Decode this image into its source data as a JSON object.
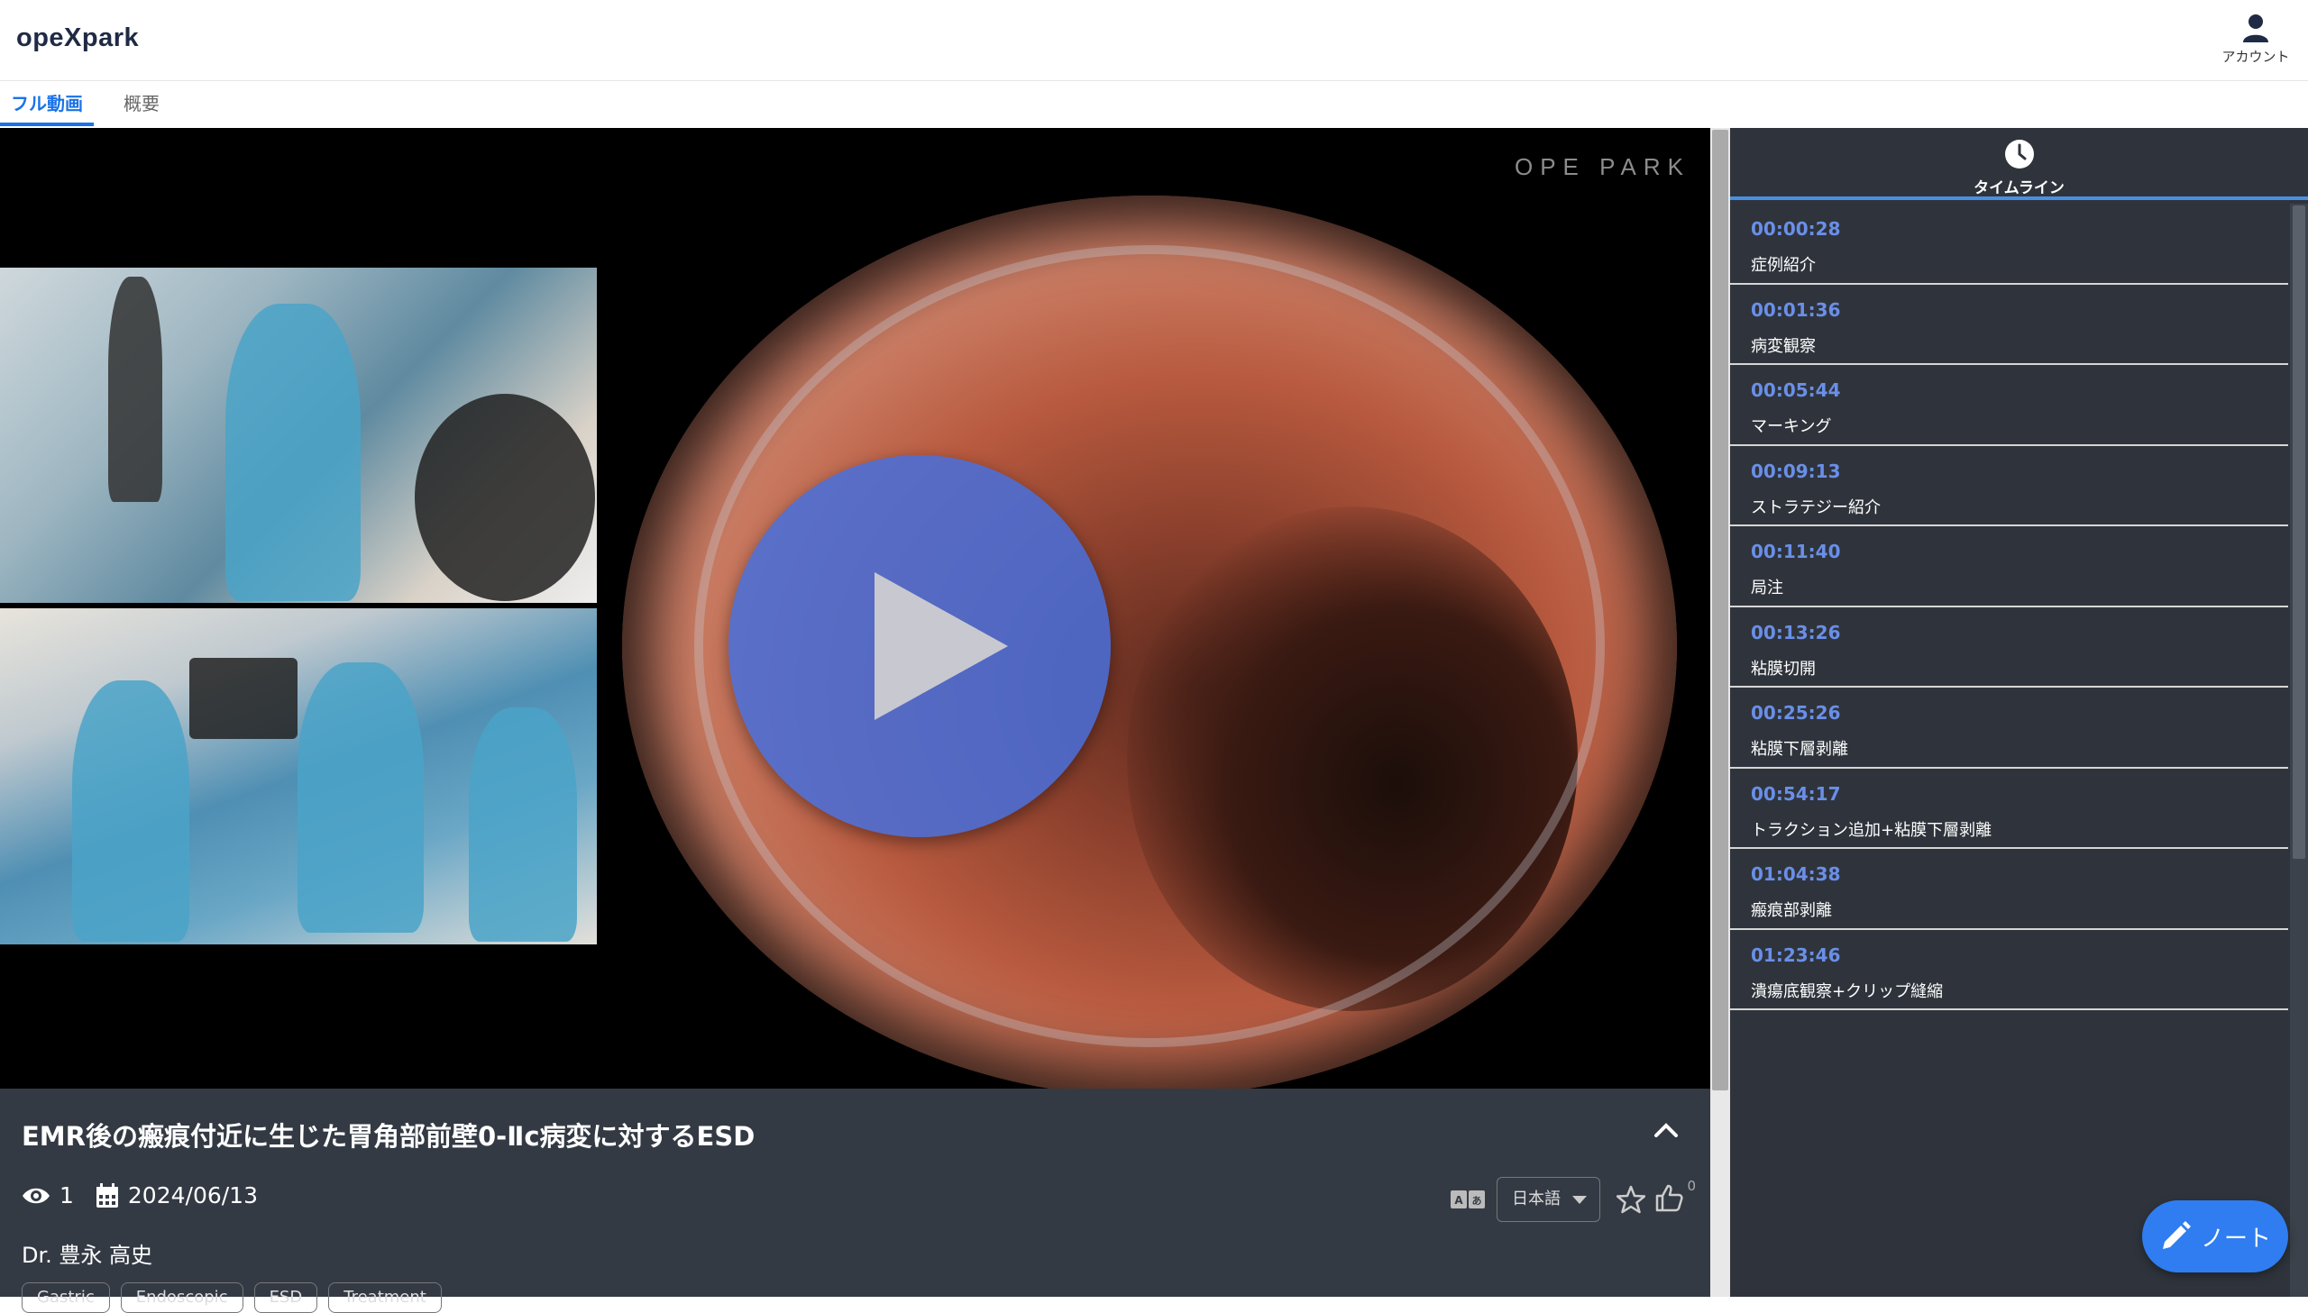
{
  "app": {
    "logo_text": "opeXpark",
    "account_label": "アカウント"
  },
  "tabs": [
    {
      "label": "フル動画",
      "active": true
    },
    {
      "label": "概要",
      "active": false
    }
  ],
  "video": {
    "watermark": "OPE PARK",
    "title": "EMR後の瘢痕付近に生じた胃角部前壁0-Ⅱc病変に対するESD",
    "views": "1",
    "date": "2024/06/13",
    "author": "Dr. 豊永 高史",
    "tags": [
      "Gastric",
      "Endoscopic",
      "ESD",
      "Treatment"
    ],
    "language_selected": "日本語",
    "likes": "0"
  },
  "timeline": {
    "header_label": "タイムライン",
    "items": [
      {
        "time": "00:00:28",
        "label": "症例紹介"
      },
      {
        "time": "00:01:36",
        "label": "病変観察"
      },
      {
        "time": "00:05:44",
        "label": "マーキング"
      },
      {
        "time": "00:09:13",
        "label": "ストラテジー紹介"
      },
      {
        "time": "00:11:40",
        "label": "局注"
      },
      {
        "time": "00:13:26",
        "label": "粘膜切開"
      },
      {
        "time": "00:25:26",
        "label": "粘膜下層剥離"
      },
      {
        "time": "00:54:17",
        "label": "トラクション追加+粘膜下層剥離"
      },
      {
        "time": "01:04:38",
        "label": "瘢痕部剥離"
      },
      {
        "time": "01:23:46",
        "label": "潰瘍底観察+クリップ縫縮"
      }
    ]
  },
  "note_button": {
    "label": "ノート"
  },
  "colors": {
    "accent": "#1a73e8",
    "timeline_bg": "#2f343c",
    "info_bg": "#343a44",
    "timestamp": "#6a8fe8",
    "play_button": "#466edc",
    "note_button": "#2f7df0"
  }
}
